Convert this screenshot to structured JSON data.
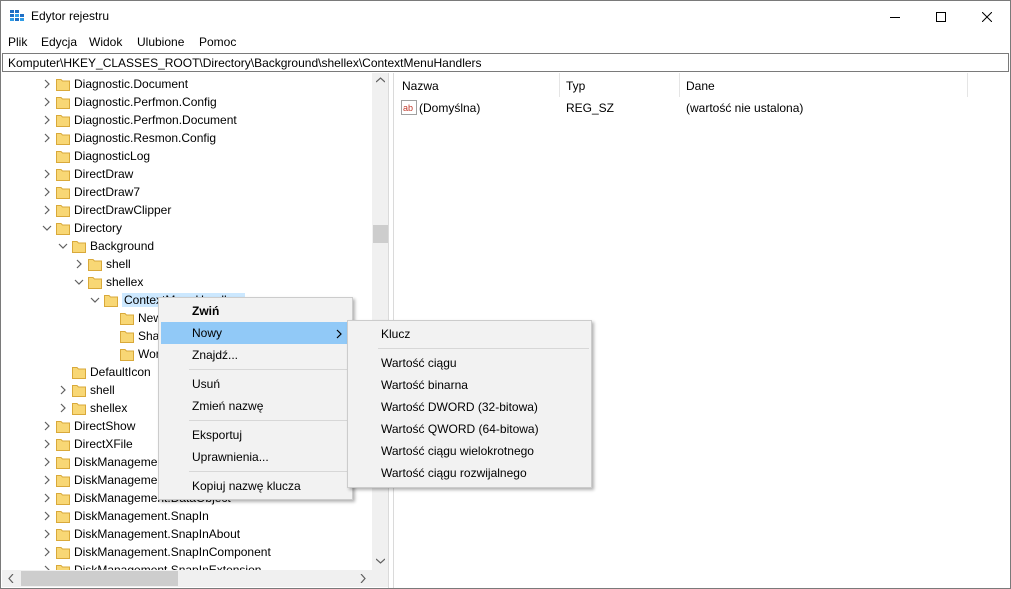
{
  "window": {
    "title": "Edytor rejestru"
  },
  "menubar": [
    "Plik",
    "Edycja",
    "Widok",
    "Ulubione",
    "Pomoc"
  ],
  "address": "Komputer\\HKEY_CLASSES_ROOT\\Directory\\Background\\shellex\\ContextMenuHandlers",
  "tree": [
    {
      "label": "Diagnostic.Document",
      "expander": "collapsed",
      "level": 0
    },
    {
      "label": "Diagnostic.Perfmon.Config",
      "expander": "collapsed",
      "level": 0
    },
    {
      "label": "Diagnostic.Perfmon.Document",
      "expander": "collapsed",
      "level": 0
    },
    {
      "label": "Diagnostic.Resmon.Config",
      "expander": "collapsed",
      "level": 0
    },
    {
      "label": "DiagnosticLog",
      "expander": "none",
      "level": 0
    },
    {
      "label": "DirectDraw",
      "expander": "collapsed",
      "level": 0
    },
    {
      "label": "DirectDraw7",
      "expander": "collapsed",
      "level": 0
    },
    {
      "label": "DirectDrawClipper",
      "expander": "collapsed",
      "level": 0
    },
    {
      "label": "Directory",
      "expander": "expanded",
      "level": 0
    },
    {
      "label": "Background",
      "expander": "expanded",
      "level": 1
    },
    {
      "label": "shell",
      "expander": "collapsed",
      "level": 2
    },
    {
      "label": "shellex",
      "expander": "expanded",
      "level": 2
    },
    {
      "label": "ContextMenuHandlers",
      "expander": "expanded",
      "level": 3,
      "selected": true
    },
    {
      "label": "New",
      "expander": "none",
      "level": 4
    },
    {
      "label": "Sharing",
      "expander": "none",
      "level": 4
    },
    {
      "label": "WorkFolders",
      "expander": "none",
      "level": 4
    },
    {
      "label": "DefaultIcon",
      "expander": "none",
      "level": 1
    },
    {
      "label": "shell",
      "expander": "collapsed",
      "level": 1
    },
    {
      "label": "shellex",
      "expander": "collapsed",
      "level": 1
    },
    {
      "label": "DirectShow",
      "expander": "collapsed",
      "level": 0
    },
    {
      "label": "DirectXFile",
      "expander": "collapsed",
      "level": 0
    },
    {
      "label": "DiskManagement.Connection",
      "expander": "collapsed",
      "level": 0
    },
    {
      "label": "DiskManagement.Control",
      "expander": "collapsed",
      "level": 0
    },
    {
      "label": "DiskManagement.DataObject",
      "expander": "collapsed",
      "level": 0
    },
    {
      "label": "DiskManagement.SnapIn",
      "expander": "collapsed",
      "level": 0
    },
    {
      "label": "DiskManagement.SnapInAbout",
      "expander": "collapsed",
      "level": 0
    },
    {
      "label": "DiskManagement.SnapInComponent",
      "expander": "collapsed",
      "level": 0
    },
    {
      "label": "DiskManagement.SnapInExtension",
      "expander": "collapsed",
      "level": 0
    }
  ],
  "list": {
    "columns": [
      "Nazwa",
      "Typ",
      "Dane"
    ],
    "rows": [
      {
        "name": "(Domyślna)",
        "type": "REG_SZ",
        "data": "(wartość nie ustalona)",
        "icon": "string-value-icon"
      }
    ]
  },
  "context_menu": {
    "items": [
      {
        "label": "Zwiń",
        "bold": true
      },
      {
        "label": "Nowy",
        "submenu": true,
        "highlighted": true
      },
      {
        "label": "Znajdź..."
      },
      {
        "sep": true
      },
      {
        "label": "Usuń"
      },
      {
        "label": "Zmień nazwę"
      },
      {
        "sep": true
      },
      {
        "label": "Eksportuj"
      },
      {
        "label": "Uprawnienia..."
      },
      {
        "sep": true
      },
      {
        "label": "Kopiuj nazwę klucza"
      }
    ]
  },
  "submenu": {
    "items": [
      {
        "label": "Klucz"
      },
      {
        "sep": true
      },
      {
        "label": "Wartość ciągu"
      },
      {
        "label": "Wartość binarna"
      },
      {
        "label": "Wartość DWORD (32-bitowa)"
      },
      {
        "label": "Wartość QWORD (64-bitowa)"
      },
      {
        "label": "Wartość ciągu wielokrotnego"
      },
      {
        "label": "Wartość ciągu rozwijalnego"
      }
    ]
  },
  "colors": {
    "selection": "#cce8ff",
    "menu_highlight": "#91c9f7",
    "folder": "#f8d775"
  }
}
